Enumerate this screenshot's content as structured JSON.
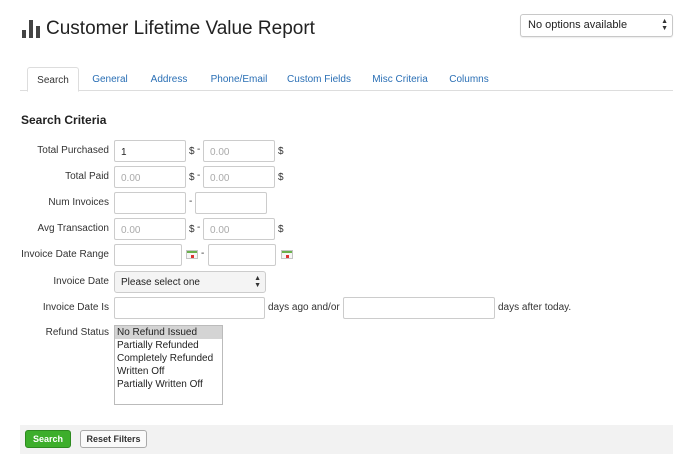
{
  "header": {
    "title": "Customer Lifetime Value Report",
    "icon": "bar-chart-icon",
    "options_select_value": "No options available"
  },
  "tabs": [
    {
      "label": "Search",
      "active": true
    },
    {
      "label": "General"
    },
    {
      "label": "Address"
    },
    {
      "label": "Phone/Email"
    },
    {
      "label": "Custom Fields"
    },
    {
      "label": "Misc Criteria"
    },
    {
      "label": "Columns"
    }
  ],
  "section_title": "Search Criteria",
  "form": {
    "total_purchased": {
      "label": "Total Purchased",
      "from_value": "1",
      "to_placeholder": "0.00",
      "currency": "$",
      "separator": "-"
    },
    "total_paid": {
      "label": "Total Paid",
      "from_placeholder": "0.00",
      "to_placeholder": "0.00",
      "currency": "$",
      "separator": "-"
    },
    "num_invoices": {
      "label": "Num Invoices",
      "separator": "-"
    },
    "avg_transaction": {
      "label": "Avg Transaction",
      "from_placeholder": "0.00",
      "to_placeholder": "0.00",
      "currency": "$",
      "separator": "-"
    },
    "invoice_date_range": {
      "label": "Invoice Date Range",
      "separator": "-",
      "calendar_icon": "calendar-icon"
    },
    "invoice_date": {
      "label": "Invoice Date",
      "selected": "Please select one"
    },
    "invoice_date_is": {
      "label": "Invoice Date Is",
      "days_ago_text": "days ago and/or",
      "days_after_text": "days after today."
    },
    "refund_status": {
      "label": "Refund Status",
      "options": [
        "No Refund Issued",
        "Partially Refunded",
        "Completely Refunded",
        "Written Off",
        "Partially Written Off"
      ]
    }
  },
  "footer": {
    "search_label": "Search",
    "reset_label": "Reset Filters",
    "search_color": "#3dae2b"
  }
}
